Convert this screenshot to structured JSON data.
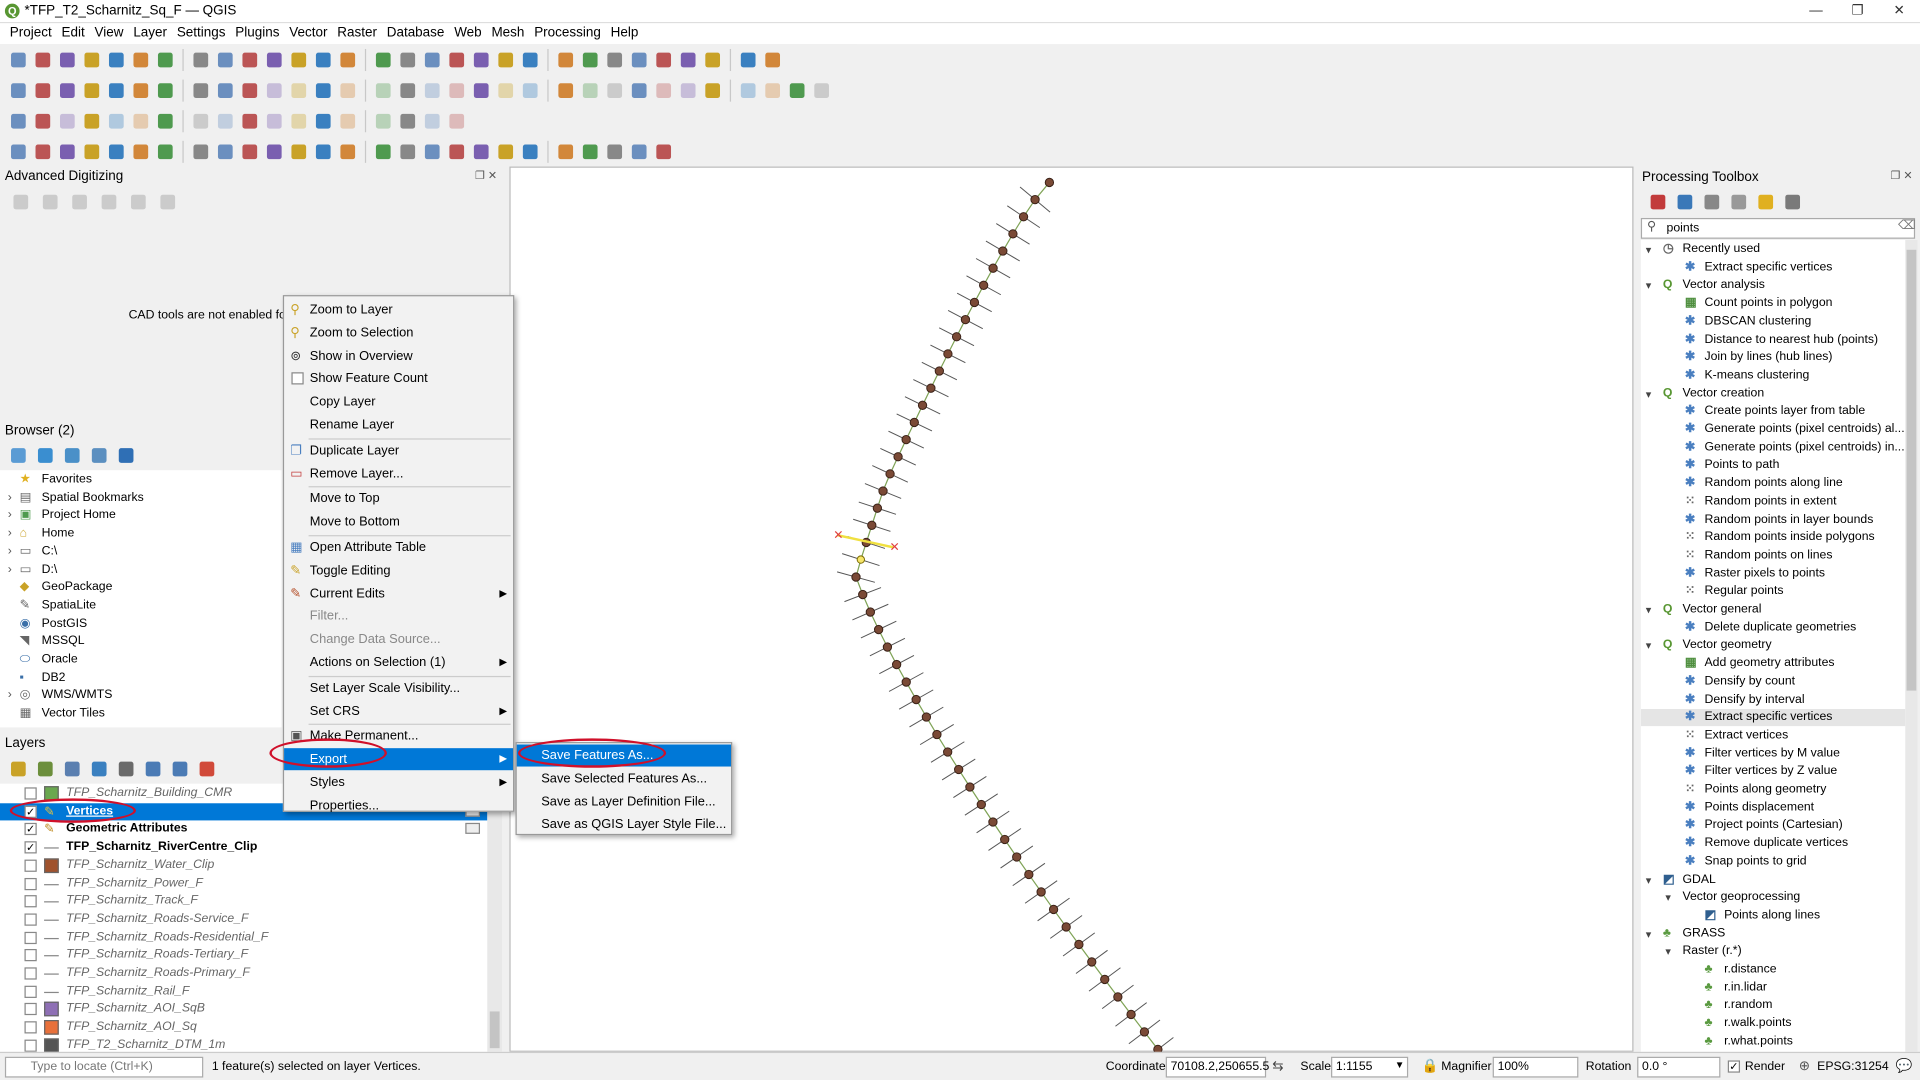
{
  "window": {
    "title": "*TFP_T2_Scharnitz_Sq_F — QGIS",
    "controls": [
      "—",
      "❐",
      "✕"
    ]
  },
  "menu": [
    "Project",
    "Edit",
    "View",
    "Layer",
    "Settings",
    "Plugins",
    "Vector",
    "Raster",
    "Database",
    "Web",
    "Mesh",
    "Processing",
    "Help"
  ],
  "advanced_digitizing": {
    "title": "Advanced Digitizing",
    "message": "CAD tools are not enabled for th"
  },
  "browser": {
    "title": "Browser (2)",
    "items": [
      "Favorites",
      "Spatial Bookmarks",
      "Project Home",
      "Home",
      "C:\\",
      "D:\\",
      "GeoPackage",
      "SpatiaLite",
      "PostGIS",
      "MSSQL",
      "Oracle",
      "DB2",
      "WMS/WMTS",
      "Vector Tiles"
    ]
  },
  "layers": {
    "title": "Layers",
    "items": [
      {
        "name": "TFP_Scharnitz_Building_CMR",
        "checked": false,
        "style": "italic",
        "swatch": "#6aa84f"
      },
      {
        "name": "Vertices",
        "checked": true,
        "style": "selected",
        "swatch": ""
      },
      {
        "name": "Geometric Attributes",
        "checked": true,
        "style": "bold",
        "swatch": ""
      },
      {
        "name": "TFP_Scharnitz_RiverCentre_Clip",
        "checked": true,
        "style": "bold",
        "swatch": ""
      },
      {
        "name": "TFP_Scharnitz_Water_Clip",
        "checked": false,
        "style": "italic",
        "swatch": "#a0522d"
      },
      {
        "name": "TFP_Scharnitz_Power_F",
        "checked": false,
        "style": "italic",
        "swatch": ""
      },
      {
        "name": "TFP_Scharnitz_Track_F",
        "checked": false,
        "style": "italic",
        "swatch": ""
      },
      {
        "name": "TFP_Scharnitz_Roads-Service_F",
        "checked": false,
        "style": "italic",
        "swatch": ""
      },
      {
        "name": "TFP_Scharnitz_Roads-Residential_F",
        "checked": false,
        "style": "italic",
        "swatch": ""
      },
      {
        "name": "TFP_Scharnitz_Roads-Tertiary_F",
        "checked": false,
        "style": "italic",
        "swatch": ""
      },
      {
        "name": "TFP_Scharnitz_Roads-Primary_F",
        "checked": false,
        "style": "italic",
        "swatch": ""
      },
      {
        "name": "TFP_Scharnitz_Rail_F",
        "checked": false,
        "style": "italic",
        "swatch": ""
      },
      {
        "name": "TFP_Scharnitz_AOI_SqB",
        "checked": false,
        "style": "italic",
        "swatch": "#8e6fb5"
      },
      {
        "name": "TFP_Scharnitz_AOI_Sq",
        "checked": false,
        "style": "italic",
        "swatch": "#e8703a"
      },
      {
        "name": "TFP_T2_Scharnitz_DTM_1m",
        "checked": false,
        "style": "italic",
        "swatch": "#555"
      }
    ]
  },
  "context_menu": [
    {
      "label": "Zoom to Layer",
      "icon": "zoom-icon"
    },
    {
      "label": "Zoom to Selection",
      "icon": "zoom-selection-icon"
    },
    {
      "label": "Show in Overview",
      "icon": "overview-icon"
    },
    {
      "label": "Show Feature Count",
      "icon": "checkbox"
    },
    {
      "label": "Copy Layer"
    },
    {
      "label": "Rename Layer"
    },
    {
      "sep": true
    },
    {
      "label": "Duplicate Layer",
      "icon": "duplicate-icon"
    },
    {
      "label": "Remove Layer...",
      "icon": "remove-icon"
    },
    {
      "sep": true
    },
    {
      "label": "Move to Top"
    },
    {
      "label": "Move to Bottom"
    },
    {
      "sep": true
    },
    {
      "label": "Open Attribute Table",
      "icon": "table-icon"
    },
    {
      "label": "Toggle Editing",
      "icon": "pencil-icon"
    },
    {
      "label": "Current Edits",
      "icon": "edits-icon",
      "sub": true
    },
    {
      "label": "Filter...",
      "disabled": true
    },
    {
      "label": "Change Data Source...",
      "disabled": true
    },
    {
      "label": "Actions on Selection (1)",
      "sub": true
    },
    {
      "sep": true
    },
    {
      "label": "Set Layer Scale Visibility..."
    },
    {
      "label": "Set CRS",
      "sub": true
    },
    {
      "sep": true
    },
    {
      "label": "Make Permanent...",
      "icon": "save-icon"
    },
    {
      "label": "Export",
      "sub": true,
      "selected": true
    },
    {
      "label": "Styles",
      "sub": true
    },
    {
      "label": "Properties..."
    }
  ],
  "export_submenu": [
    "Save Features As...",
    "Save Selected Features As...",
    "Save as Layer Definition File...",
    "Save as QGIS Layer Style File..."
  ],
  "processing": {
    "title": "Processing Toolbox",
    "search": "points",
    "tree": [
      {
        "label": "Recently used",
        "level": 0,
        "icon": "clock"
      },
      {
        "label": "Extract specific vertices",
        "level": 1,
        "icon": "gear"
      },
      {
        "label": "Vector analysis",
        "level": 0,
        "icon": "q"
      },
      {
        "label": "Count points in polygon",
        "level": 1,
        "icon": "algo"
      },
      {
        "label": "DBSCAN clustering",
        "level": 1,
        "icon": "gear"
      },
      {
        "label": "Distance to nearest hub (points)",
        "level": 1,
        "icon": "gear"
      },
      {
        "label": "Join by lines (hub lines)",
        "level": 1,
        "icon": "gear"
      },
      {
        "label": "K-means clustering",
        "level": 1,
        "icon": "gear"
      },
      {
        "label": "Vector creation",
        "level": 0,
        "icon": "q"
      },
      {
        "label": "Create points layer from table",
        "level": 1,
        "icon": "gear"
      },
      {
        "label": "Generate points (pixel centroids) al...",
        "level": 1,
        "icon": "gear"
      },
      {
        "label": "Generate points (pixel centroids) in...",
        "level": 1,
        "icon": "gear"
      },
      {
        "label": "Points to path",
        "level": 1,
        "icon": "gear"
      },
      {
        "label": "Random points along line",
        "level": 1,
        "icon": "gear"
      },
      {
        "label": "Random points in extent",
        "level": 1,
        "icon": "dots"
      },
      {
        "label": "Random points in layer bounds",
        "level": 1,
        "icon": "gear"
      },
      {
        "label": "Random points inside polygons",
        "level": 1,
        "icon": "dots"
      },
      {
        "label": "Random points on lines",
        "level": 1,
        "icon": "dots"
      },
      {
        "label": "Raster pixels to points",
        "level": 1,
        "icon": "gear"
      },
      {
        "label": "Regular points",
        "level": 1,
        "icon": "dots"
      },
      {
        "label": "Vector general",
        "level": 0,
        "icon": "q"
      },
      {
        "label": "Delete duplicate geometries",
        "level": 1,
        "icon": "gear"
      },
      {
        "label": "Vector geometry",
        "level": 0,
        "icon": "q"
      },
      {
        "label": "Add geometry attributes",
        "level": 1,
        "icon": "algo"
      },
      {
        "label": "Densify by count",
        "level": 1,
        "icon": "gear"
      },
      {
        "label": "Densify by interval",
        "level": 1,
        "icon": "gear"
      },
      {
        "label": "Extract specific vertices",
        "level": 1,
        "icon": "gear",
        "hl": true
      },
      {
        "label": "Extract vertices",
        "level": 1,
        "icon": "dots"
      },
      {
        "label": "Filter vertices by M value",
        "level": 1,
        "icon": "gear"
      },
      {
        "label": "Filter vertices by Z value",
        "level": 1,
        "icon": "gear"
      },
      {
        "label": "Points along geometry",
        "level": 1,
        "icon": "dots"
      },
      {
        "label": "Points displacement",
        "level": 1,
        "icon": "gear"
      },
      {
        "label": "Project points (Cartesian)",
        "level": 1,
        "icon": "gear"
      },
      {
        "label": "Remove duplicate vertices",
        "level": 1,
        "icon": "gear"
      },
      {
        "label": "Snap points to grid",
        "level": 1,
        "icon": "gear"
      },
      {
        "label": "GDAL",
        "level": 0,
        "icon": "gdal"
      },
      {
        "label": "Vector geoprocessing",
        "level": 1,
        "icon": "none",
        "expander": true
      },
      {
        "label": "Points along lines",
        "level": 2,
        "icon": "gdal"
      },
      {
        "label": "GRASS",
        "level": 0,
        "icon": "grass"
      },
      {
        "label": "Raster (r.*)",
        "level": 1,
        "icon": "none",
        "expander": true
      },
      {
        "label": "r.distance",
        "level": 2,
        "icon": "grass"
      },
      {
        "label": "r.in.lidar",
        "level": 2,
        "icon": "grass"
      },
      {
        "label": "r.random",
        "level": 2,
        "icon": "grass"
      },
      {
        "label": "r.walk.points",
        "level": 2,
        "icon": "grass"
      },
      {
        "label": "r.what.points",
        "level": 2,
        "icon": "grass"
      }
    ]
  },
  "status": {
    "locate_placeholder": "Type to locate (Ctrl+K)",
    "message": "1 feature(s) selected on layer Vertices.",
    "coordinate_label": "Coordinate",
    "coordinate": "70108.2,250655.5",
    "scale_label": "Scale",
    "scale": "1:1155",
    "magnifier_label": "Magnifier",
    "magnifier": "100%",
    "rotation_label": "Rotation",
    "rotation": "0.0 °",
    "render_label": "Render",
    "crs": "EPSG:31254"
  },
  "colors": {
    "accent": "#0078d7",
    "highlight_ring": "#d0102a",
    "vertex": "#7a4a36",
    "line": "#7fa356"
  }
}
